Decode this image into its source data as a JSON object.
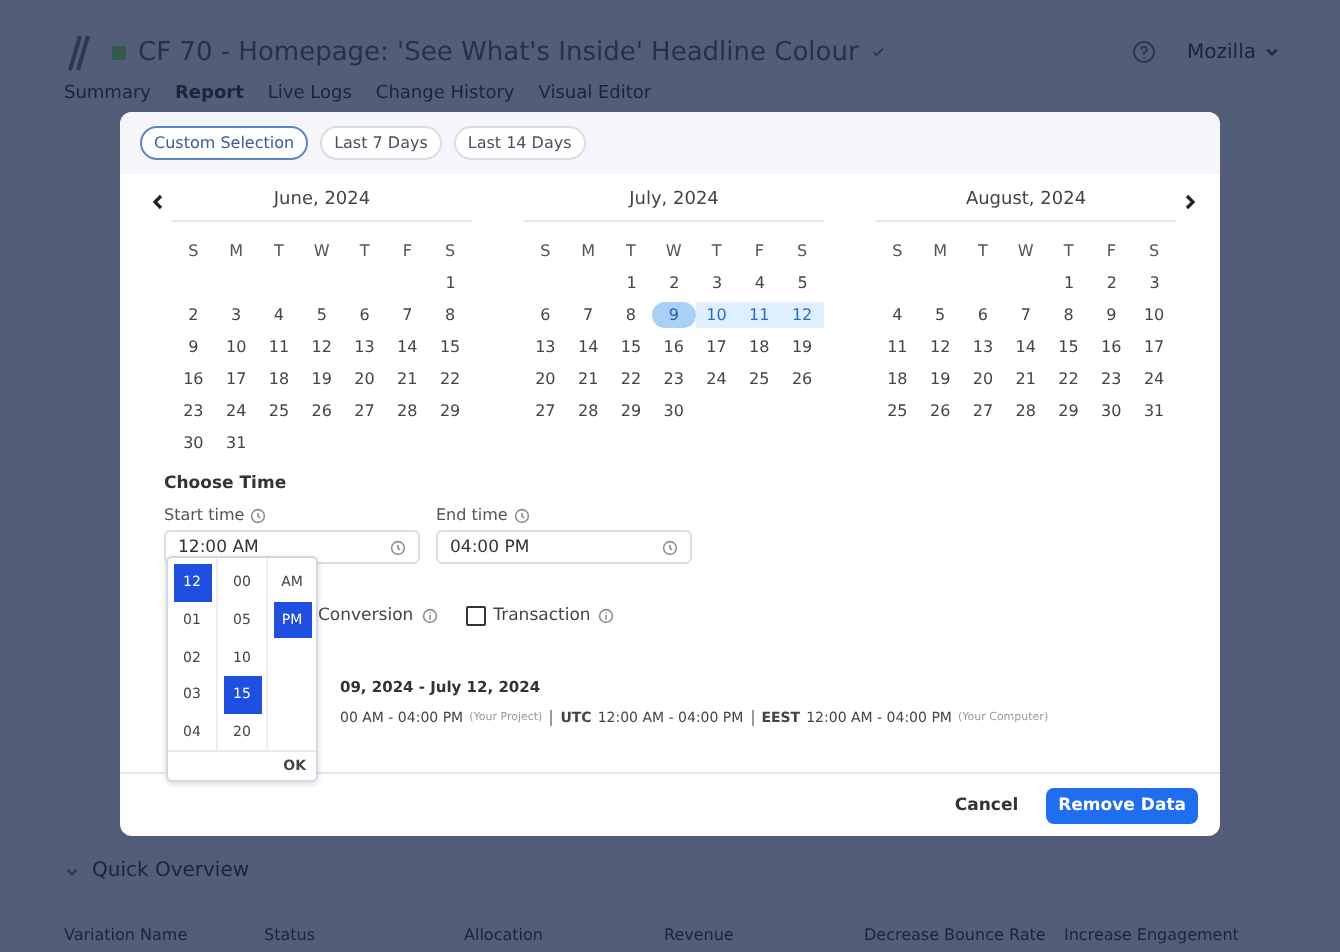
{
  "background": {
    "title": "CF 70 - Homepage: 'See What's Inside' Headline Colour",
    "account": "Mozilla",
    "tabs": [
      {
        "label": "Summary",
        "selected": false
      },
      {
        "label": "Report",
        "selected": true
      },
      {
        "label": "Live Logs",
        "selected": false
      },
      {
        "label": "Change History",
        "selected": false
      },
      {
        "label": "Visual Editor",
        "selected": false
      }
    ],
    "section": "Quick Overview",
    "columns": [
      "Variation Name",
      "Status",
      "Allocation",
      "Revenue",
      "Decrease Bounce Rate",
      "Increase Engagement"
    ]
  },
  "presets": [
    {
      "label": "Custom Selection",
      "selected": true
    },
    {
      "label": "Last 7 Days",
      "selected": false
    },
    {
      "label": "Last 14 Days",
      "selected": false
    }
  ],
  "months": [
    {
      "title": "June, 2024",
      "weekdays": [
        "S",
        "M",
        "T",
        "W",
        "T",
        "F",
        "S"
      ],
      "weeks": [
        [
          {
            "label": "1",
            "selected": false
          }
        ],
        [
          {
            "label": "2",
            "selected": false
          },
          {
            "label": "3",
            "selected": false
          },
          {
            "label": "4",
            "selected": false
          },
          {
            "label": "5",
            "selected": false
          },
          {
            "label": "6",
            "selected": false
          },
          {
            "label": "7",
            "selected": false
          },
          {
            "label": "8",
            "selected": false
          }
        ],
        [
          {
            "label": "9",
            "selected": false
          },
          {
            "label": "10",
            "selected": false
          },
          {
            "label": "11",
            "selected": false
          },
          {
            "label": "12",
            "selected": false
          },
          {
            "label": "13",
            "selected": false
          },
          {
            "label": "14",
            "selected": false
          },
          {
            "label": "15",
            "selected": false
          }
        ],
        [
          {
            "label": "16",
            "selected": false
          },
          {
            "label": "17",
            "selected": false
          },
          {
            "label": "18",
            "selected": false
          },
          {
            "label": "19",
            "selected": false
          },
          {
            "label": "20",
            "selected": false
          },
          {
            "label": "21",
            "selected": false
          },
          {
            "label": "22",
            "selected": false
          }
        ],
        [
          {
            "label": "23",
            "selected": false
          },
          {
            "label": "24",
            "selected": false
          },
          {
            "label": "25",
            "selected": false
          },
          {
            "label": "26",
            "selected": false
          },
          {
            "label": "27",
            "selected": false
          },
          {
            "label": "28",
            "selected": false
          },
          {
            "label": "29",
            "selected": false
          }
        ],
        [
          {
            "label": "30",
            "selected": false
          },
          {
            "label": "31",
            "selected": false
          }
        ]
      ]
    },
    {
      "title": "July, 2024",
      "weekdays": [
        "S",
        "M",
        "T",
        "W",
        "T",
        "F",
        "S"
      ],
      "weeks": [
        [
          {
            "label": "1",
            "selected": false
          },
          {
            "label": "2",
            "selected": false
          },
          {
            "label": "3",
            "selected": false
          },
          {
            "label": "4",
            "selected": false
          },
          {
            "label": "5",
            "selected": false
          }
        ],
        [
          {
            "label": "6",
            "selected": false
          },
          {
            "label": "7",
            "selected": false
          },
          {
            "label": "8",
            "selected": false
          },
          {
            "label": "9",
            "selected": true
          },
          {
            "label": "10",
            "selected": true
          },
          {
            "label": "11",
            "selected": true
          },
          {
            "label": "12",
            "selected": true
          }
        ],
        [
          {
            "label": "13",
            "selected": false
          },
          {
            "label": "14",
            "selected": false
          },
          {
            "label": "15",
            "selected": false
          },
          {
            "label": "16",
            "selected": false
          },
          {
            "label": "17",
            "selected": false
          },
          {
            "label": "18",
            "selected": false
          },
          {
            "label": "19",
            "selected": false
          }
        ],
        [
          {
            "label": "20",
            "selected": false
          },
          {
            "label": "21",
            "selected": false
          },
          {
            "label": "22",
            "selected": false
          },
          {
            "label": "23",
            "selected": false
          },
          {
            "label": "24",
            "selected": false
          },
          {
            "label": "25",
            "selected": false
          },
          {
            "label": "26",
            "selected": false
          }
        ],
        [
          {
            "label": "27",
            "selected": false
          },
          {
            "label": "28",
            "selected": false
          },
          {
            "label": "29",
            "selected": false
          },
          {
            "label": "30",
            "selected": false
          }
        ]
      ]
    },
    {
      "title": "August, 2024",
      "weekdays": [
        "S",
        "M",
        "T",
        "W",
        "T",
        "F",
        "S"
      ],
      "weeks": [
        [
          {
            "label": "1",
            "selected": false
          },
          {
            "label": "2",
            "selected": false
          },
          {
            "label": "3",
            "selected": false
          }
        ],
        [
          {
            "label": "4",
            "selected": false
          },
          {
            "label": "5",
            "selected": false
          },
          {
            "label": "6",
            "selected": false
          },
          {
            "label": "7",
            "selected": false
          },
          {
            "label": "8",
            "selected": false
          },
          {
            "label": "9",
            "selected": false
          },
          {
            "label": "10",
            "selected": false
          }
        ],
        [
          {
            "label": "11",
            "selected": false
          },
          {
            "label": "12",
            "selected": false
          },
          {
            "label": "13",
            "selected": false
          },
          {
            "label": "14",
            "selected": false
          },
          {
            "label": "15",
            "selected": false
          },
          {
            "label": "16",
            "selected": false
          },
          {
            "label": "17",
            "selected": false
          }
        ],
        [
          {
            "label": "18",
            "selected": false
          },
          {
            "label": "19",
            "selected": false
          },
          {
            "label": "20",
            "selected": false
          },
          {
            "label": "21",
            "selected": false
          },
          {
            "label": "22",
            "selected": false
          },
          {
            "label": "23",
            "selected": false
          },
          {
            "label": "24",
            "selected": false
          }
        ],
        [
          {
            "label": "25",
            "selected": false
          },
          {
            "label": "26",
            "selected": false
          },
          {
            "label": "27",
            "selected": false
          },
          {
            "label": "28",
            "selected": false
          },
          {
            "label": "29",
            "selected": false
          },
          {
            "label": "30",
            "selected": false
          },
          {
            "label": "31",
            "selected": false
          }
        ]
      ]
    }
  ],
  "time": {
    "heading": "Choose Time",
    "start": {
      "label": "Start time",
      "value": "12:00 AM"
    },
    "end": {
      "label": "End time",
      "value": "04:00 PM"
    },
    "picker": {
      "hours": [
        {
          "label": "12",
          "selected": true
        },
        {
          "label": "01",
          "selected": false
        },
        {
          "label": "02",
          "selected": false
        },
        {
          "label": "03",
          "selected": false
        },
        {
          "label": "04",
          "selected": false
        }
      ],
      "minutes": [
        {
          "label": "00",
          "selected": false
        },
        {
          "label": "05",
          "selected": false
        },
        {
          "label": "10",
          "selected": false
        },
        {
          "label": "15",
          "selected": true
        },
        {
          "label": "20",
          "selected": false
        }
      ],
      "periods": [
        {
          "label": "AM",
          "selected": false
        },
        {
          "label": "PM",
          "selected": true
        }
      ],
      "ok": "OK"
    }
  },
  "goals": [
    {
      "label": "Conversion"
    },
    {
      "label": "Transaction",
      "checked": false
    }
  ],
  "range": "09, 2024 - July 12, 2024",
  "timezones": [
    {
      "time": "00 AM - 04:00 PM",
      "note": "(Your Project)"
    },
    {
      "zone": "UTC",
      "time": "12:00 AM - 04:00 PM"
    },
    {
      "zone": "EEST",
      "time": "12:00 AM - 04:00 PM",
      "note": "(Your Computer)"
    }
  ],
  "buttons": {
    "cancel": "Cancel",
    "confirm": "Remove Data"
  }
}
